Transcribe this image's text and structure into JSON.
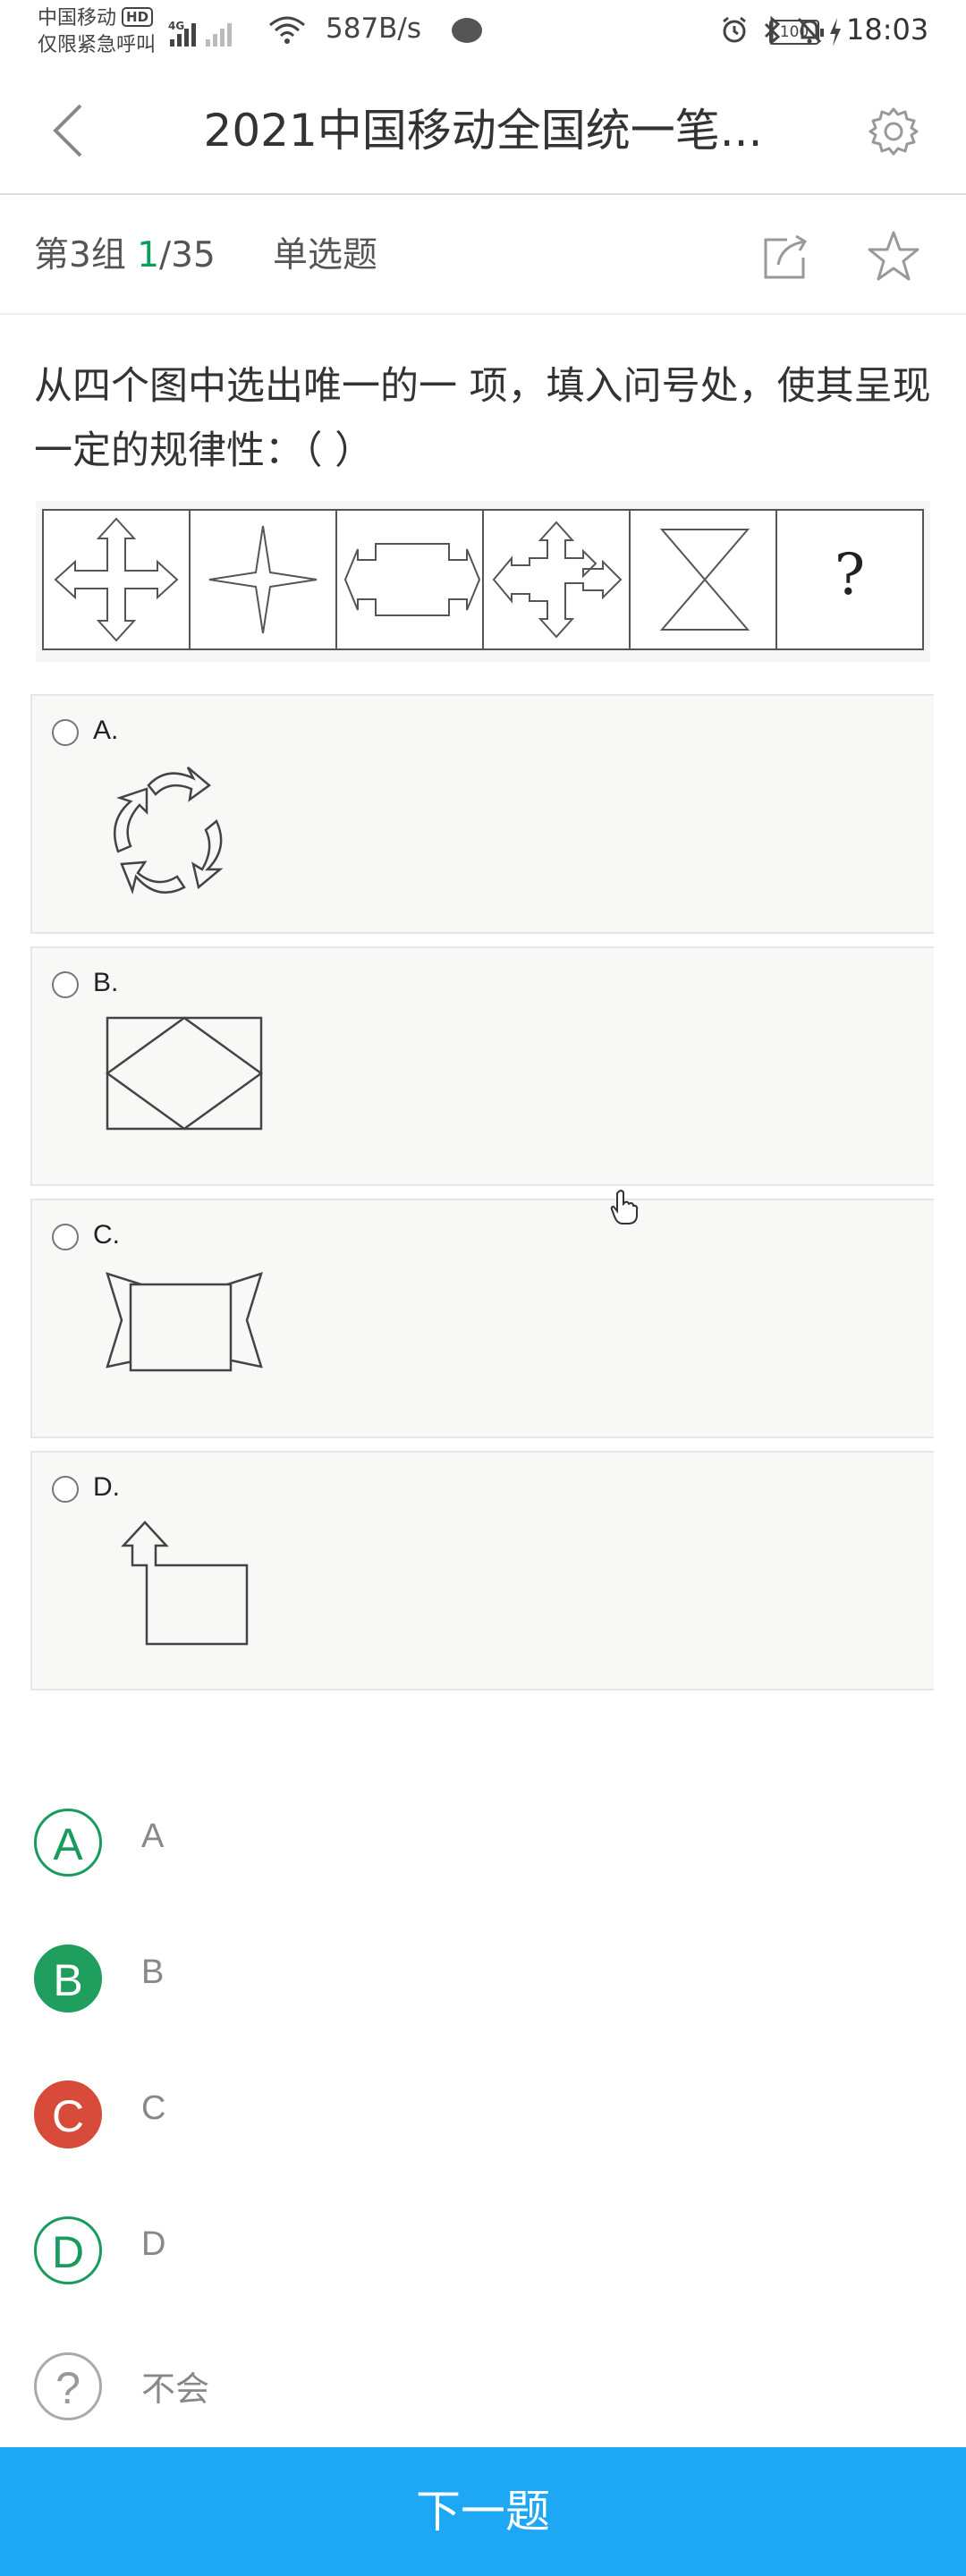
{
  "status_bar": {
    "carrier_line1": "中国移动",
    "hd_badge": "HD",
    "carrier_line2": "仅限紧急呼叫",
    "net_tag": "4G",
    "speed": "587B/s",
    "battery": "100",
    "time": "18:03"
  },
  "header": {
    "title": "2021中国移动全国统一笔..."
  },
  "info": {
    "group_prefix": "第3组 ",
    "current": "1",
    "total": "/35",
    "question_type": "单选题"
  },
  "question": {
    "text": "从四个图中选出唯一的一 项，填入问号处，使其呈现一定的规律性：（ ）",
    "stem_missing": "?"
  },
  "options": [
    {
      "label": "A."
    },
    {
      "label": "B."
    },
    {
      "label": "C."
    },
    {
      "label": "D."
    }
  ],
  "choices": [
    {
      "letter": "A",
      "text": "A"
    },
    {
      "letter": "B",
      "text": "B"
    },
    {
      "letter": "C",
      "text": "C"
    },
    {
      "letter": "D",
      "text": "D"
    },
    {
      "letter": "?",
      "text": "不会"
    }
  ],
  "next_button": "下一题",
  "colors": {
    "accent_green": "#1a9b5e",
    "wrong_red": "#d84a3a",
    "next_blue": "#1ea7f4"
  }
}
